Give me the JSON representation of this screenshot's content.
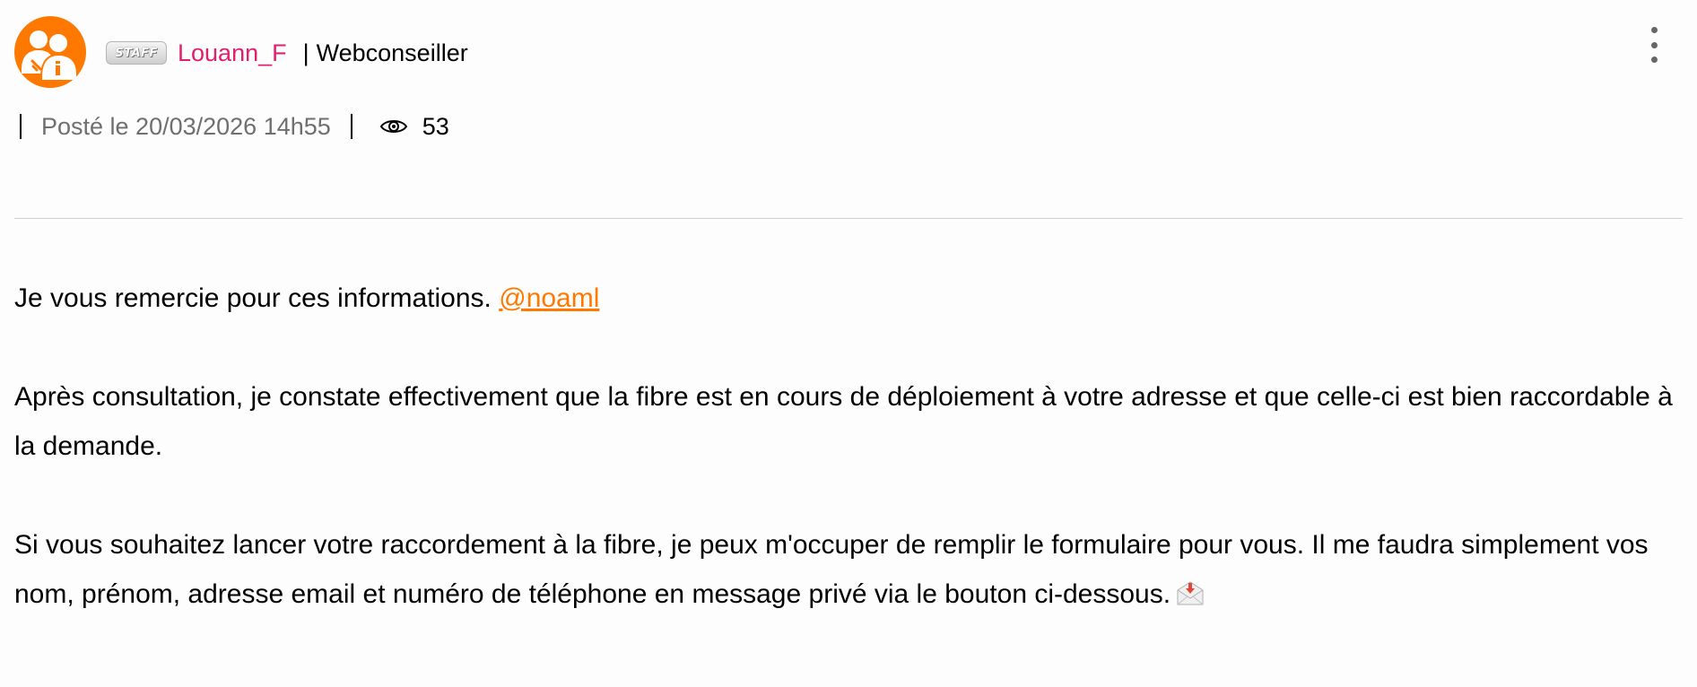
{
  "author": {
    "badge_text": "STAFF",
    "name": "Louann_F",
    "separator": "|",
    "role": "Webconseiller"
  },
  "avatar": {
    "icon": "community-users-icon",
    "background": "#ff7900"
  },
  "menu": {
    "icon": "kebab-menu-icon"
  },
  "meta": {
    "posted": "Posté le 20/03/2026 14h55",
    "views_icon": "eye-icon",
    "views": "53"
  },
  "colors": {
    "accent": "#ff7900",
    "author_name": "#e0206f",
    "meta_text": "#6f6f6f",
    "divider": "#cfcfcf"
  },
  "message": {
    "line1_text": "Je vous remercie pour ces informations.",
    "mention": "@noaml",
    "paragraph2": "Après consultation, je constate effectivement que la fibre est en cours de déploiement à votre adresse et que celle-ci est bien raccordable à la demande.",
    "paragraph3": "Si vous souhaitez lancer votre raccordement à la fibre, je peux m'occuper de remplir le formulaire pour vous. Il me faudra simplement vos nom, prénom, adresse email et numéro de téléphone en message privé via le bouton ci-dessous.",
    "paragraph3_icon": "envelope-inbox-icon"
  }
}
